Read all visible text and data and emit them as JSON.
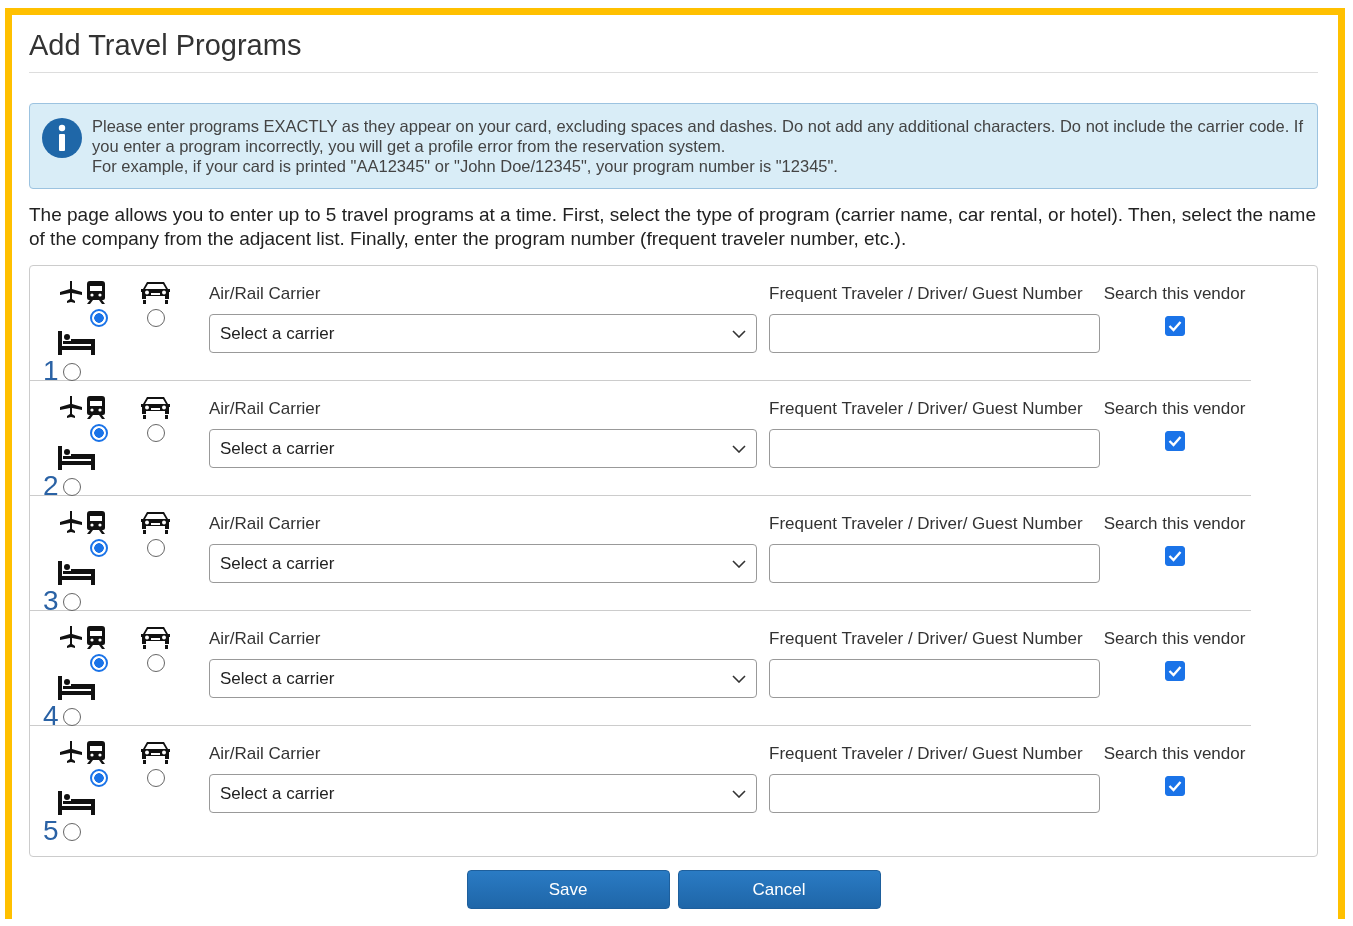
{
  "title": "Add Travel Programs",
  "notice": [
    "Please enter programs EXACTLY as they appear on your card, excluding spaces and dashes. Do not add any additional characters. Do not include the carrier code. If you enter a program incorrectly, you will get a profile error from the reservation system.",
    "For example, if your card is printed \"AA12345\" or \"John Doe/12345\", your program number is \"12345\"."
  ],
  "intro": "The page allows you to enter up to 5 travel programs at a time. First, select the type of program (carrier name, car rental, or hotel). Then, select the name of the company from the adjacent list. Finally, enter the program number (frequent traveler number, etc.).",
  "programs": [
    {
      "number": "1",
      "types": [
        {
          "kind": "air",
          "selected": true
        },
        {
          "kind": "car",
          "selected": false
        },
        {
          "kind": "hotel",
          "selected": false
        }
      ],
      "carrier_label": "Air/Rail Carrier",
      "carrier_select": "Select a carrier",
      "number_label": "Frequent Traveler / Driver/ Guest Number",
      "search_label": "Search this vendor",
      "search_checked": true
    },
    {
      "number": "2",
      "types": [
        {
          "kind": "air",
          "selected": true
        },
        {
          "kind": "car",
          "selected": false
        },
        {
          "kind": "hotel",
          "selected": false
        }
      ],
      "carrier_label": "Air/Rail Carrier",
      "carrier_select": "Select a carrier",
      "number_label": "Frequent Traveler / Driver/ Guest Number",
      "search_label": "Search this vendor",
      "search_checked": true
    },
    {
      "number": "3",
      "types": [
        {
          "kind": "air",
          "selected": true
        },
        {
          "kind": "car",
          "selected": false
        },
        {
          "kind": "hotel",
          "selected": false
        }
      ],
      "carrier_label": "Air/Rail Carrier",
      "carrier_select": "Select a carrier",
      "number_label": "Frequent Traveler / Driver/ Guest Number",
      "search_label": "Search this vendor",
      "search_checked": true
    },
    {
      "number": "4",
      "types": [
        {
          "kind": "air",
          "selected": true
        },
        {
          "kind": "car",
          "selected": false
        },
        {
          "kind": "hotel",
          "selected": false
        }
      ],
      "carrier_label": "Air/Rail Carrier",
      "carrier_select": "Select a carrier",
      "number_label": "Frequent Traveler / Driver/ Guest Number",
      "search_label": "Search this vendor",
      "search_checked": true
    },
    {
      "number": "5",
      "types": [
        {
          "kind": "air",
          "selected": true
        },
        {
          "kind": "car",
          "selected": false
        },
        {
          "kind": "hotel",
          "selected": false
        }
      ],
      "carrier_label": "Air/Rail Carrier",
      "carrier_select": "Select a carrier",
      "number_label": "Frequent Traveler / Driver/ Guest Number",
      "search_label": "Search this vendor",
      "search_checked": true
    }
  ],
  "buttons": [
    "Save",
    "Cancel"
  ]
}
